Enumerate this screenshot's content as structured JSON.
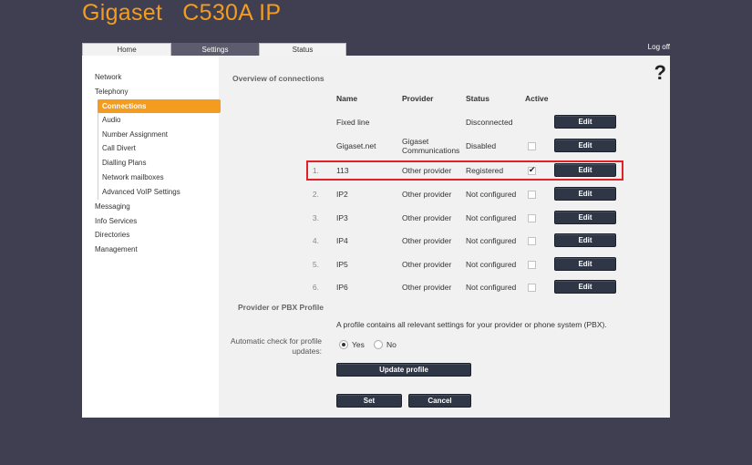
{
  "brand": {
    "name": "Gigaset",
    "model": "C530A IP"
  },
  "tabs": [
    {
      "label": "Home"
    },
    {
      "label": "Settings"
    },
    {
      "label": "Status"
    }
  ],
  "logoff": "Log off",
  "help": "?",
  "sidebar": {
    "network": "Network",
    "telephony": "Telephony",
    "connections": "Connections",
    "audio": "Audio",
    "number_assignment": "Number Assignment",
    "call_divert": "Call Divert",
    "dialling_plans": "Dialling Plans",
    "network_mailboxes": "Network mailboxes",
    "advanced_voip": "Advanced VoIP Settings",
    "messaging": "Messaging",
    "info_services": "Info Services",
    "directories": "Directories",
    "management": "Management"
  },
  "overview": {
    "title": "Overview of connections",
    "headers": {
      "name": "Name",
      "provider": "Provider",
      "status": "Status",
      "active": "Active"
    },
    "edit_label": "Edit",
    "rows": [
      {
        "num": "",
        "name": "Fixed line",
        "provider": "",
        "status": "Disconnected",
        "active": null
      },
      {
        "num": "",
        "name": "Gigaset.net",
        "provider_line1": "Gigaset",
        "provider_line2": "Communications",
        "status": "Disabled",
        "active": false
      },
      {
        "num": "1.",
        "name": "113",
        "provider": "Other provider",
        "status": "Registered",
        "active": true
      },
      {
        "num": "2.",
        "name": "IP2",
        "provider": "Other provider",
        "status": "Not configured",
        "active": false
      },
      {
        "num": "3.",
        "name": "IP3",
        "provider": "Other provider",
        "status": "Not configured",
        "active": false
      },
      {
        "num": "4.",
        "name": "IP4",
        "provider": "Other provider",
        "status": "Not configured",
        "active": false
      },
      {
        "num": "5.",
        "name": "IP5",
        "provider": "Other provider",
        "status": "Not configured",
        "active": false
      },
      {
        "num": "6.",
        "name": "IP6",
        "provider": "Other provider",
        "status": "Not configured",
        "active": false
      }
    ]
  },
  "profile": {
    "title": "Provider or PBX Profile",
    "description": "A profile contains all relevant settings for your provider or phone system (PBX).",
    "auto_check_label_1": "Automatic check for profile",
    "auto_check_label_2": "updates:",
    "yes": "Yes",
    "no": "No",
    "selected": "yes",
    "update_button": "Update profile"
  },
  "actions": {
    "set": "Set",
    "cancel": "Cancel"
  },
  "colors": {
    "accent": "#f39c1f",
    "background": "#403f52",
    "button": "#2f3746",
    "highlight": "#e32026"
  }
}
